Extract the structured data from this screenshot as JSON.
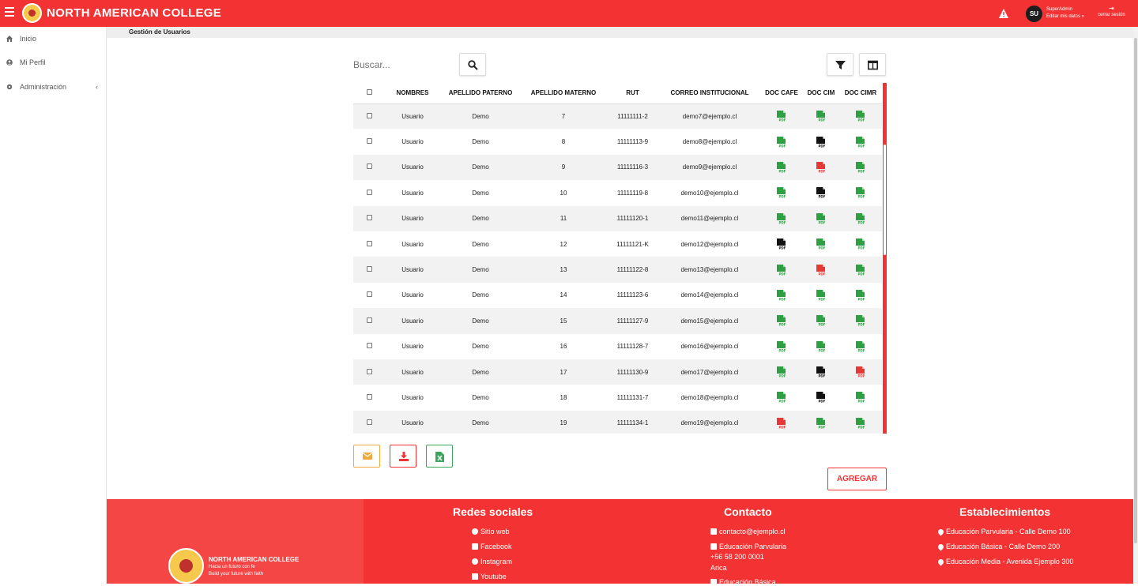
{
  "app": {
    "brand": "NORTH AMERICAN COLLEGE"
  },
  "user": {
    "initials": "SU",
    "name": "SuperAdmin",
    "edit_label": "Editar mis datos »",
    "logout_label": "cerrar sesión"
  },
  "sidebar": {
    "items": [
      {
        "label": "Inicio",
        "icon": "home-icon"
      },
      {
        "label": "Mi Perfil",
        "icon": "user-icon"
      },
      {
        "label": "Administración",
        "icon": "gear-icon"
      }
    ]
  },
  "breadcrumb": "Gestión de Usuarios",
  "search": {
    "placeholder": "Buscar..."
  },
  "table": {
    "headers": [
      "NOMBRES",
      "APELLIDO PATERNO",
      "APELLIDO MATERNO",
      "RUT",
      "CORREO INSTITUCIONAL",
      "DOC CAFE",
      "DOC CIM",
      "DOC CIMR"
    ],
    "rows": [
      {
        "nombres": "Usuario",
        "paterno": "Demo",
        "materno": "7",
        "rut": "11111111-2",
        "correo": "demo7@ejemplo.cl",
        "docs": [
          "green",
          "green",
          "green"
        ]
      },
      {
        "nombres": "Usuario",
        "paterno": "Demo",
        "materno": "8",
        "rut": "11111113-9",
        "correo": "demo8@ejemplo.cl",
        "docs": [
          "green",
          "black",
          "green"
        ]
      },
      {
        "nombres": "Usuario",
        "paterno": "Demo",
        "materno": "9",
        "rut": "11111116-3",
        "correo": "demo9@ejemplo.cl",
        "docs": [
          "green",
          "red",
          "green"
        ]
      },
      {
        "nombres": "Usuario",
        "paterno": "Demo",
        "materno": "10",
        "rut": "11111119-8",
        "correo": "demo10@ejemplo.cl",
        "docs": [
          "green",
          "black",
          "green"
        ]
      },
      {
        "nombres": "Usuario",
        "paterno": "Demo",
        "materno": "11",
        "rut": "11111120-1",
        "correo": "demo11@ejemplo.cl",
        "docs": [
          "green",
          "green",
          "green"
        ]
      },
      {
        "nombres": "Usuario",
        "paterno": "Demo",
        "materno": "12",
        "rut": "11111121-K",
        "correo": "demo12@ejemplo.cl",
        "docs": [
          "black",
          "green",
          "green"
        ]
      },
      {
        "nombres": "Usuario",
        "paterno": "Demo",
        "materno": "13",
        "rut": "11111122-8",
        "correo": "demo13@ejemplo.cl",
        "docs": [
          "green",
          "red",
          "green"
        ]
      },
      {
        "nombres": "Usuario",
        "paterno": "Demo",
        "materno": "14",
        "rut": "11111123-6",
        "correo": "demo14@ejemplo.cl",
        "docs": [
          "green",
          "green",
          "green"
        ]
      },
      {
        "nombres": "Usuario",
        "paterno": "Demo",
        "materno": "15",
        "rut": "11111127-9",
        "correo": "demo15@ejemplo.cl",
        "docs": [
          "green",
          "green",
          "green"
        ]
      },
      {
        "nombres": "Usuario",
        "paterno": "Demo",
        "materno": "16",
        "rut": "11111128-7",
        "correo": "demo16@ejemplo.cl",
        "docs": [
          "green",
          "green",
          "green"
        ]
      },
      {
        "nombres": "Usuario",
        "paterno": "Demo",
        "materno": "17",
        "rut": "11111130-9",
        "correo": "demo17@ejemplo.cl",
        "docs": [
          "green",
          "black",
          "red"
        ]
      },
      {
        "nombres": "Usuario",
        "paterno": "Demo",
        "materno": "18",
        "rut": "11111131-7",
        "correo": "demo18@ejemplo.cl",
        "docs": [
          "green",
          "black",
          "green"
        ]
      },
      {
        "nombres": "Usuario",
        "paterno": "Demo",
        "materno": "19",
        "rut": "11111134-1",
        "correo": "demo19@ejemplo.cl",
        "docs": [
          "red",
          "green",
          "green"
        ]
      }
    ]
  },
  "actions": {
    "email_icon": "envelope-icon",
    "pdf_icon": "download-icon",
    "excel_icon": "excel-icon",
    "add_label": "AGREGAR"
  },
  "colors": {
    "brand": "#f33333",
    "pdf_green": "#2ea043",
    "pdf_red": "#e53935",
    "pdf_black": "#111111",
    "email_btn": "#f0a93b",
    "excel_btn": "#3aa55d"
  },
  "footer": {
    "college": "NORTH AMERICAN COLLEGE",
    "tagline1": "Hacia un futuro con fe",
    "tagline2": "Build your future with faith",
    "social": {
      "title": "Redes sociales",
      "items": [
        "Sitio web",
        "Facebook",
        "Instagram",
        "Youtube"
      ]
    },
    "contact": {
      "title": "Contacto",
      "email": "contacto@ejemplo.cl",
      "parvularia": "Educación Parvularia",
      "phone": "+56 58 200 0001",
      "city": "Arica",
      "basica": "Educación Básica"
    },
    "establishments": {
      "title": "Establecimientos",
      "items": [
        "Educación Parvularia - Calle Demo 100",
        "Educación Básica - Calle Demo 200",
        "Educación Media - Avenida Ejemplo 300"
      ]
    }
  }
}
